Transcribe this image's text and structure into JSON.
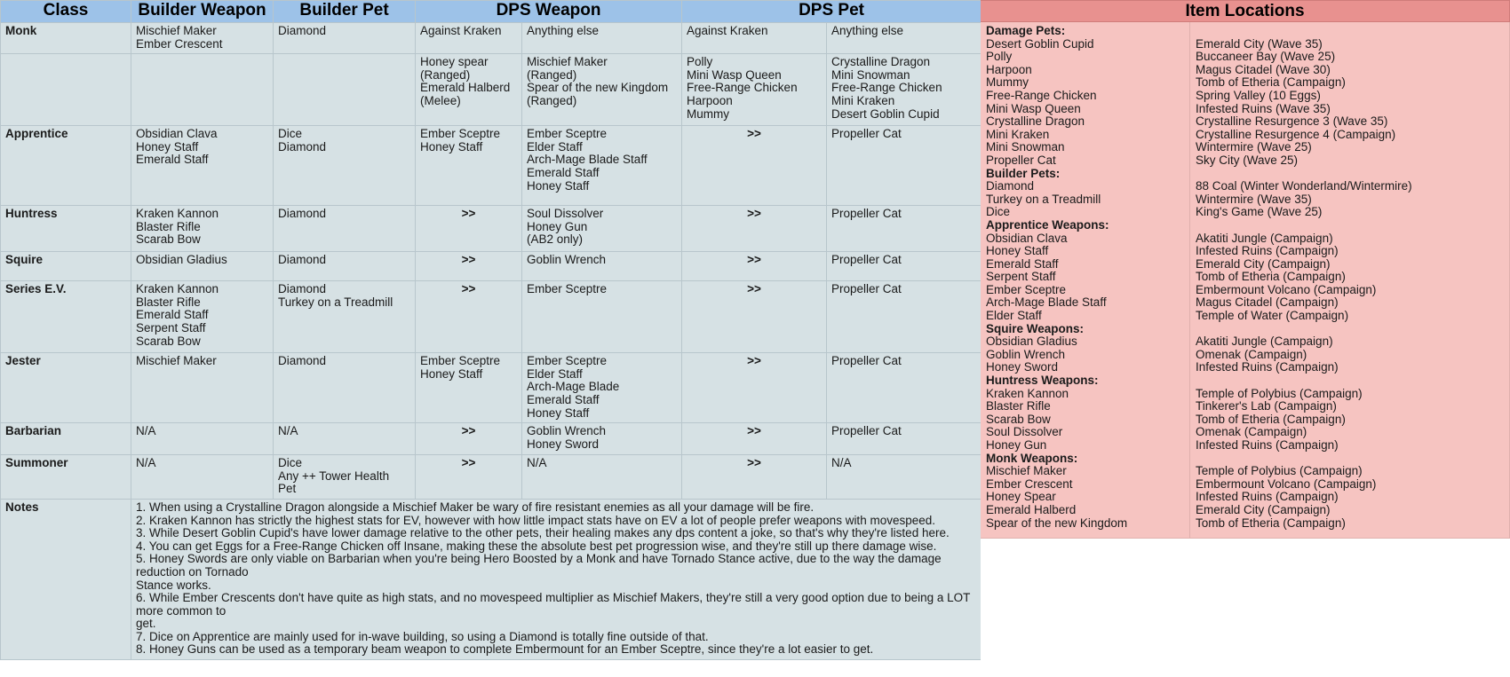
{
  "table": {
    "headers": {
      "class": "Class",
      "builder_weapon": "Builder Weapon",
      "builder_pet": "Builder Pet",
      "dps_weapon": "DPS Weapon",
      "dps_pet": "DPS Pet"
    },
    "rows": [
      {
        "class": "Monk",
        "builder_weapon": "Mischief Maker\nEmber Crescent",
        "builder_pet": "Diamond",
        "dps_weapon_kraken": "Against Kraken",
        "dps_weapon_else": "Anything else",
        "dps_pet_kraken": "Against Kraken",
        "dps_pet_else": "Anything else"
      },
      {
        "class": "",
        "builder_weapon": "",
        "builder_pet": "",
        "dps_weapon_kraken": "Honey spear\n(Ranged)\nEmerald Halberd\n(Melee)",
        "dps_weapon_else": "Mischief Maker\n(Ranged)\nSpear of the new Kingdom\n(Ranged)",
        "dps_pet_kraken": "Polly\nMini Wasp Queen\nFree-Range Chicken\nHarpoon\nMummy",
        "dps_pet_else": "Crystalline Dragon\nMini Snowman\nFree-Range Chicken\nMini Kraken\nDesert Goblin Cupid"
      },
      {
        "class": "Apprentice",
        "builder_weapon": "Obsidian Clava\nHoney Staff\nEmerald Staff",
        "builder_pet": "Dice\nDiamond",
        "dps_weapon_kraken": "Ember Sceptre\nHoney Staff",
        "dps_weapon_else": "Ember Sceptre\nElder Staff\nArch-Mage Blade Staff\nEmerald Staff\nHoney Staff",
        "dps_pet_kraken": ">>",
        "dps_pet_else": "Propeller Cat"
      },
      {
        "class": "Huntress",
        "builder_weapon": "Kraken Kannon\nBlaster Rifle\nScarab Bow",
        "builder_pet": "Diamond",
        "dps_weapon_kraken": ">>",
        "dps_weapon_else": "Soul Dissolver\nHoney Gun\n(AB2 only)",
        "dps_pet_kraken": ">>",
        "dps_pet_else": "Propeller Cat"
      },
      {
        "class": "Squire",
        "builder_weapon": "Obsidian Gladius",
        "builder_pet": "Diamond",
        "dps_weapon_kraken": ">>",
        "dps_weapon_else": "Goblin Wrench",
        "dps_pet_kraken": ">>",
        "dps_pet_else": "Propeller Cat"
      },
      {
        "class": "Series E.V.",
        "builder_weapon": "Kraken Kannon\nBlaster Rifle\nEmerald Staff\nSerpent Staff\nScarab Bow",
        "builder_pet": "Diamond\nTurkey on a Treadmill",
        "dps_weapon_kraken": ">>",
        "dps_weapon_else": "Ember Sceptre",
        "dps_pet_kraken": ">>",
        "dps_pet_else": "Propeller Cat"
      },
      {
        "class": "Jester",
        "builder_weapon": "Mischief Maker",
        "builder_pet": "Diamond",
        "dps_weapon_kraken": "Ember Sceptre\nHoney Staff",
        "dps_weapon_else": "Ember Sceptre\nElder Staff\nArch-Mage Blade\nEmerald Staff\nHoney Staff",
        "dps_pet_kraken": ">>",
        "dps_pet_else": "Propeller Cat"
      },
      {
        "class": "Barbarian",
        "builder_weapon": "N/A",
        "builder_pet": "N/A",
        "dps_weapon_kraken": ">>",
        "dps_weapon_else": "Goblin Wrench\nHoney Sword",
        "dps_pet_kraken": ">>",
        "dps_pet_else": "Propeller Cat"
      },
      {
        "class": "Summoner",
        "builder_weapon": "N/A",
        "builder_pet": "Dice\nAny ++ Tower Health Pet",
        "dps_weapon_kraken": ">>",
        "dps_weapon_else": "N/A",
        "dps_pet_kraken": ">>",
        "dps_pet_else": "N/A"
      }
    ],
    "notes_label": "Notes",
    "notes": [
      "1. When using a Crystalline Dragon alongside a Mischief Maker be wary of fire resistant enemies as all your damage will be fire.",
      "2. Kraken Kannon has strictly the highest stats for EV, however with how little impact stats have on EV a lot of people prefer weapons with movespeed.",
      "3. While Desert Goblin Cupid's have lower damage relative to the other pets, their healing makes any dps content a joke, so that's why they're listed here.",
      "4. You can get Eggs for a Free-Range Chicken off Insane, making these the absolute best pet progression wise, and they're still up there damage wise.",
      "5. Honey Swords are only viable on Barbarian when you're being Hero Boosted by a Monk and have Tornado Stance active, due to the way the damage reduction on Tornado",
      "Stance works.",
      "6. While Ember Crescents don't have quite as high stats, and no movespeed multiplier as Mischief Makers, they're still a very good option due to being a LOT more common to",
      "get.",
      "7. Dice on Apprentice are mainly used for in-wave building, so using a Diamond is totally fine outside of that.",
      "8. Honey Guns can be used as a temporary beam weapon to complete Embermount for an Ember Sceptre, since they're a lot easier to get."
    ]
  },
  "item_locations": {
    "title": "Item Locations",
    "entries": [
      {
        "name": "Damage Pets:",
        "place": "",
        "header": true
      },
      {
        "name": "Desert Goblin Cupid",
        "place": "Emerald City (Wave 35)"
      },
      {
        "name": "Polly",
        "place": "Buccaneer Bay (Wave 25)"
      },
      {
        "name": "Harpoon",
        "place": "Magus Citadel (Wave 30)"
      },
      {
        "name": "Mummy",
        "place": "Tomb of Etheria (Campaign)"
      },
      {
        "name": "Free-Range Chicken",
        "place": "Spring Valley (10 Eggs)"
      },
      {
        "name": "Mini Wasp Queen",
        "place": "Infested Ruins (Wave 35)"
      },
      {
        "name": "Crystalline Dragon",
        "place": "Crystalline Resurgence 3 (Wave 35)"
      },
      {
        "name": "Mini Kraken",
        "place": "Crystalline Resurgence 4 (Campaign)"
      },
      {
        "name": "Mini Snowman",
        "place": "Wintermire (Wave 25)"
      },
      {
        "name": "Propeller Cat",
        "place": "Sky City (Wave 25)"
      },
      {
        "name": "Builder Pets:",
        "place": "",
        "header": true
      },
      {
        "name": "Diamond",
        "place": "88 Coal (Winter Wonderland/Wintermire)"
      },
      {
        "name": "Turkey on a Treadmill",
        "place": "Wintermire (Wave 35)"
      },
      {
        "name": "Dice",
        "place": "King's Game (Wave 25)"
      },
      {
        "name": "Apprentice Weapons:",
        "place": "",
        "header": true
      },
      {
        "name": "Obsidian Clava",
        "place": "Akatiti Jungle (Campaign)"
      },
      {
        "name": "Honey Staff",
        "place": "Infested Ruins (Campaign)"
      },
      {
        "name": "Emerald Staff",
        "place": "Emerald City (Campaign)"
      },
      {
        "name": "Serpent Staff",
        "place": "Tomb of Etheria (Campaign)"
      },
      {
        "name": "Ember Sceptre",
        "place": "Embermount Volcano (Campaign)"
      },
      {
        "name": "Arch-Mage Blade Staff",
        "place": "Magus Citadel (Campaign)"
      },
      {
        "name": "Elder Staff",
        "place": "Temple of Water (Campaign)"
      },
      {
        "name": "Squire Weapons:",
        "place": "",
        "header": true
      },
      {
        "name": "Obsidian Gladius",
        "place": "Akatiti Jungle (Campaign)"
      },
      {
        "name": "Goblin Wrench",
        "place": "Omenak (Campaign)"
      },
      {
        "name": "Honey Sword",
        "place": "Infested Ruins (Campaign)"
      },
      {
        "name": "Huntress Weapons:",
        "place": "",
        "header": true
      },
      {
        "name": "Kraken Kannon",
        "place": "Temple of Polybius (Campaign)"
      },
      {
        "name": "Blaster Rifle",
        "place": "Tinkerer's Lab (Campaign)"
      },
      {
        "name": "Scarab Bow",
        "place": "Tomb of Etheria (Campaign)"
      },
      {
        "name": "Soul Dissolver",
        "place": "Omenak (Campaign)"
      },
      {
        "name": "Honey Gun",
        "place": "Infested Ruins (Campaign)"
      },
      {
        "name": "Monk Weapons:",
        "place": "",
        "header": true
      },
      {
        "name": "Mischief Maker",
        "place": "Temple of Polybius (Campaign)"
      },
      {
        "name": "Ember Crescent",
        "place": "Embermount Volcano (Campaign)"
      },
      {
        "name": "Honey Spear",
        "place": "Infested Ruins (Campaign)"
      },
      {
        "name": "Emerald Halberd",
        "place": "Emerald City (Campaign)"
      },
      {
        "name": "Spear of the new Kingdom",
        "place": "Tomb of Etheria (Campaign)"
      }
    ]
  },
  "colors": {
    "header_blue": "#9dc2e8",
    "cell_blue": "#d6e1e4",
    "notes_blue": "#cfe0f3",
    "loc_header_red": "#e8918f",
    "loc_body_pink": "#f6c4c1"
  }
}
